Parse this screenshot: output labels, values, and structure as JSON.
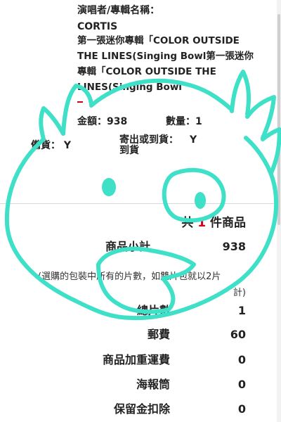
{
  "item": {
    "label": "演唱者/專輯名稱：",
    "artist": "CORTIS",
    "title_lines": [
      "第一張迷你專輯「COLOR OUTSIDE",
      "THE LINES(Singing Bowl第一張迷你",
      "專輯「COLOR OUTSIDE THE",
      "LINES(Singing Bowl"
    ],
    "amount": "金額：938",
    "quantity": "數量：1",
    "stock": "備貨： Y",
    "ship_or_arrive_label": "寄出或到貨：",
    "ship_or_arrive_value": "Y",
    "ship_or_arrive_suffix": "到貨"
  },
  "summary": {
    "total_prefix": "共",
    "total_count": "1",
    "total_suffix": "件商品",
    "subtotal_label": "商品小計",
    "subtotal_value": "938",
    "note_line1": "(選購的包裝中所有的片數，如雙片包就以2片",
    "note_line2": "計)",
    "discs_label": "總片數",
    "discs_value": "1",
    "shipping_label": "郵費",
    "shipping_value": "60",
    "weight_fee_label": "商品加重運費",
    "weight_fee_value": "0",
    "poster_tube_label": "海報筒",
    "poster_tube_value": "0",
    "deposit_label": "保留金扣除",
    "deposit_value": "0"
  },
  "colors": {
    "text": "#222222",
    "accent_red": "#d0021b",
    "doodle": "#3ee0c8"
  }
}
